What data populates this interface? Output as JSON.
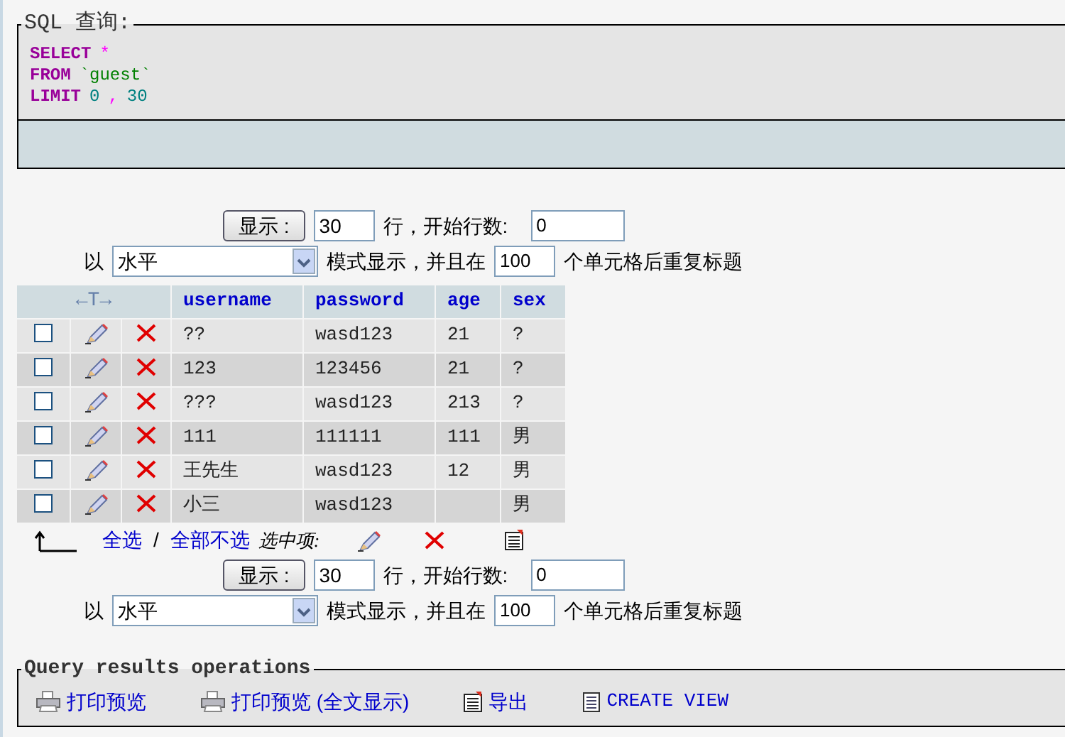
{
  "sql_query": {
    "legend": "SQL 查询:",
    "lines": [
      [
        {
          "kind": "keyword",
          "text": "SELECT"
        },
        {
          "kind": "operator",
          "text": "*"
        }
      ],
      [
        {
          "kind": "keyword",
          "text": "FROM"
        },
        {
          "kind": "identifier",
          "text": "`guest`"
        }
      ],
      [
        {
          "kind": "keyword",
          "text": "LIMIT"
        },
        {
          "kind": "number",
          "text": "0"
        },
        {
          "kind": "punct",
          "text": ","
        },
        {
          "kind": "number",
          "text": "30"
        }
      ]
    ]
  },
  "navigation_top": {
    "button": "显示 :",
    "rows": "30",
    "rows_label": "行，开始行数:",
    "start": "0",
    "mode_prefix": "以",
    "mode": "水平",
    "mode_label": "模式显示，并且在",
    "repeat": "100",
    "repeat_label": "个单元格后重复标题"
  },
  "table": {
    "arrows_header": "←T→",
    "columns": [
      "username",
      "password",
      "age",
      "sex"
    ],
    "rows": [
      {
        "checked": false,
        "cells": [
          "??",
          "wasd123",
          "21",
          "?"
        ]
      },
      {
        "checked": false,
        "cells": [
          "123",
          "123456",
          "21",
          "?"
        ]
      },
      {
        "checked": false,
        "cells": [
          "???",
          "wasd123",
          "213",
          "?"
        ]
      },
      {
        "checked": false,
        "cells": [
          "111",
          "111111",
          "111",
          "男"
        ]
      },
      {
        "checked": false,
        "cells": [
          "王先生",
          "wasd123",
          "12",
          "男"
        ]
      },
      {
        "checked": false,
        "cells": [
          "小三",
          "wasd123",
          "",
          "男"
        ]
      }
    ]
  },
  "selection": {
    "check_all": "全选",
    "separator": "/",
    "uncheck_all": "全部不选",
    "with_selected": "选中项:"
  },
  "navigation_bottom": {
    "button": "显示 :",
    "rows": "30",
    "rows_label": "行，开始行数:",
    "start": "0",
    "mode_prefix": "以",
    "mode": "水平",
    "mode_label": "模式显示，并且在",
    "repeat": "100",
    "repeat_label": "个单元格后重复标题"
  },
  "operations": {
    "legend": "Query results operations",
    "items": [
      {
        "kind": "print",
        "label": "打印预览"
      },
      {
        "kind": "print",
        "label": "打印预览 (全文显示)"
      },
      {
        "kind": "export",
        "label": "导出"
      },
      {
        "kind": "view",
        "label": "CREATE VIEW"
      }
    ]
  }
}
